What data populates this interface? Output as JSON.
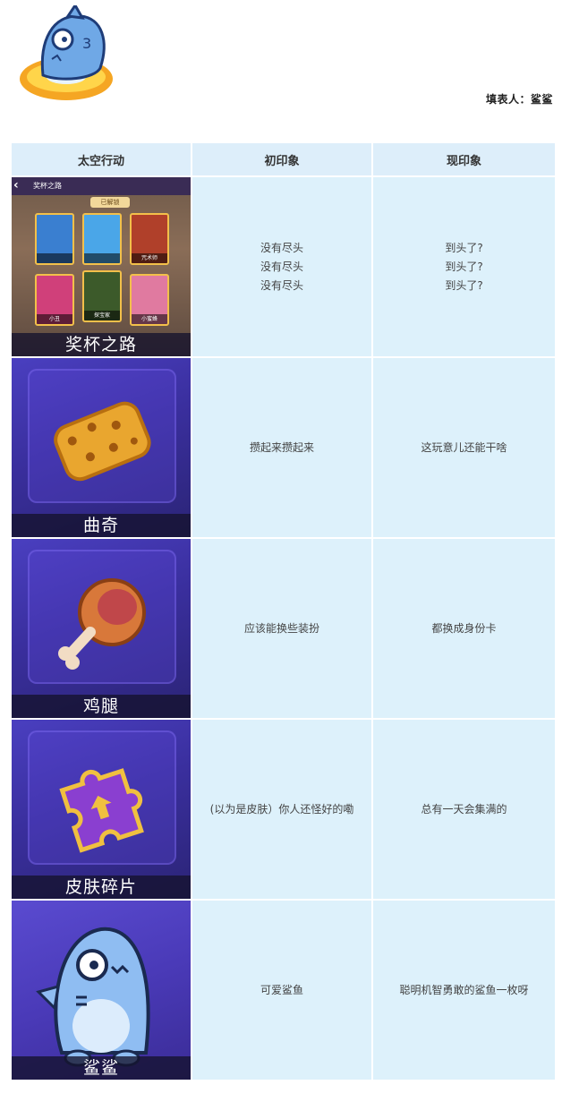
{
  "header": {
    "filler_label": "填表人：",
    "filler_name": "鲨鲨"
  },
  "table": {
    "columns": [
      "太空行动",
      "初印象",
      "现印象"
    ],
    "rows": [
      {
        "caption": "奖杯之路",
        "first": [
          "没有尽头",
          "没有尽头",
          "没有尽头"
        ],
        "now": [
          "到头了?",
          "到头了?",
          "到头了?"
        ],
        "thumb": {
          "title": "奖杯之路",
          "sub": "已解锁",
          "cards": [
            "",
            "",
            "咒术师",
            "小丑",
            "探宝家",
            "小蜜蜂"
          ]
        }
      },
      {
        "caption": "曲奇",
        "first": [
          "攒起来攒起来"
        ],
        "now": [
          "这玩意儿还能干啥"
        ]
      },
      {
        "caption": "鸡腿",
        "first": [
          "应该能换些装扮"
        ],
        "now": [
          "都换成身份卡"
        ]
      },
      {
        "caption": "皮肤碎片",
        "first": [
          "(以为是皮肤）你人还怪好的嘞"
        ],
        "now": [
          "总有一天会集满的"
        ]
      },
      {
        "caption": "鲨鲨",
        "first": [
          "可爱鲨鱼"
        ],
        "now": [
          "聪明机智勇敢的鲨鱼一枚呀"
        ]
      }
    ]
  },
  "colors": {
    "header_bg": "#ddeefa",
    "cell_bg": "#ddf1fb",
    "thumb_bg": "#3a2f9e"
  }
}
